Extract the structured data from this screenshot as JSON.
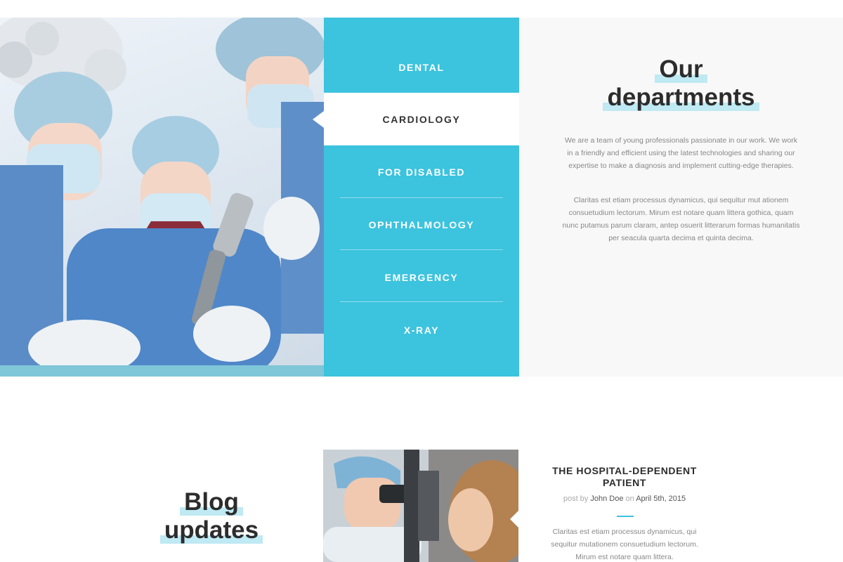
{
  "departments": {
    "items": [
      {
        "label": "DENTAL",
        "active": false
      },
      {
        "label": "CARDIOLOGY",
        "active": true
      },
      {
        "label": "FOR DISABLED",
        "active": false
      },
      {
        "label": "OPHTHALMOLOGY",
        "active": false
      },
      {
        "label": "EMERGENCY",
        "active": false
      },
      {
        "label": "X-RAY",
        "active": false
      }
    ],
    "title_line1": "Our",
    "title_line2": "departments",
    "paragraph1": "We are a team of young professionals passionate in our work. We work in a friendly and efficient using the latest technologies and sharing our expertise to make a diagnosis and implement cutting-edge therapies.",
    "paragraph2": "Claritas est etiam processus dynamicus, qui sequitur mut ationem consuetudium lectorum. Mirum est notare quam littera gothica, quam nunc putamus parum claram, antep osuerit litterarum formas humanitatis per seacula quarta decima et quinta decima."
  },
  "blog": {
    "title_line1": "Blog",
    "title_line2": "updates",
    "post": {
      "title": "THE HOSPITAL-DEPENDENT PATIENT",
      "meta_prefix": "post by",
      "author": "John Doe",
      "meta_on": "on",
      "date": "April 5th, 2015",
      "excerpt": "Claritas est etiam processus dynamicus, qui sequitur mutationem consuetudium lectorum. Mirum est notare quam littera."
    }
  },
  "colors": {
    "accent": "#3cc3de",
    "highlight": "#bfe9f3",
    "heading": "#2c2c2c",
    "body_text": "#888888"
  },
  "icons": {
    "surgery_photo": "surgeons-operating-photo",
    "blog_photo": "eye-exam-photo"
  }
}
